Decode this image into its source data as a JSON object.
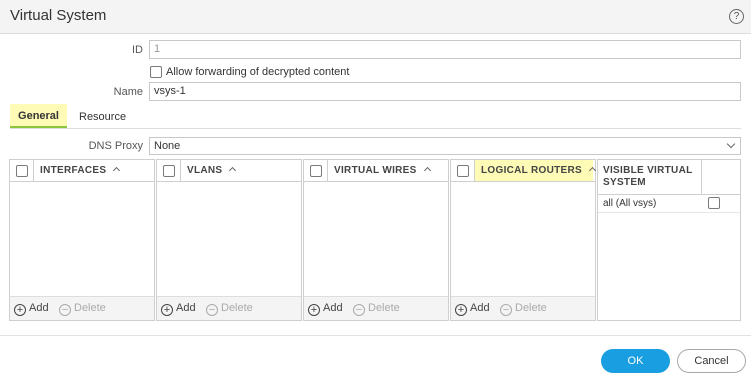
{
  "dialog": {
    "title": "Virtual System",
    "help_icon": "?"
  },
  "form": {
    "id_label": "ID",
    "id_value": "1",
    "allow_forwarding_label": "Allow forwarding of decrypted content",
    "allow_forwarding_checked": false,
    "name_label": "Name",
    "name_value": "vsys-1"
  },
  "tabs": [
    {
      "label": "General",
      "active": true
    },
    {
      "label": "Resource",
      "active": false
    }
  ],
  "dns_proxy": {
    "label": "DNS Proxy",
    "value": "None"
  },
  "panels": [
    {
      "title": "INTERFACES",
      "add_label": "Add",
      "delete_label": "Delete",
      "highlighted": false
    },
    {
      "title": "VLANS",
      "add_label": "Add",
      "delete_label": "Delete",
      "highlighted": false
    },
    {
      "title": "VIRTUAL WIRES",
      "add_label": "Add",
      "delete_label": "Delete",
      "highlighted": false
    },
    {
      "title": "LOGICAL ROUTERS",
      "add_label": "Add",
      "delete_label": "Delete",
      "highlighted": true
    }
  ],
  "visible_virtual_system": {
    "title": "VISIBLE VIRTUAL SYSTEM",
    "rows": [
      {
        "label": "all (All vsys)",
        "checked": false
      }
    ]
  },
  "footer": {
    "ok_label": "OK",
    "cancel_label": "Cancel"
  },
  "colors": {
    "highlight": "#fdfbb5",
    "ok_button": "#1a9ee2",
    "active_tab_underline": "#8cc63e"
  },
  "icons": {
    "help": "help-icon",
    "dropdown": "chevron-down-icon",
    "sort": "chevron-up-icon",
    "add": "plus-circle-icon",
    "delete": "minus-circle-icon"
  }
}
